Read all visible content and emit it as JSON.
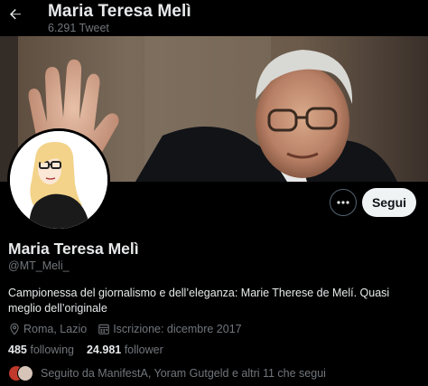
{
  "header": {
    "name": "Maria Teresa Melì",
    "tweet_count": "6.291 Tweet"
  },
  "profile": {
    "name": "Maria Teresa Melì",
    "handle": "@MT_Meli_",
    "bio": "Campionessa del giornalismo e dell’eleganza: Marie Therese de Melí. Quasi meglio dell’originale",
    "location": "Roma, Lazio",
    "joined": "Iscrizione: dicembre 2017",
    "following_count": "485",
    "following_label": "following",
    "followers_count": "24.981",
    "followers_label": "follower",
    "followed_by": "Seguito da ManifestA, Yoram Gutgeld e altri 11 che segui"
  },
  "actions": {
    "follow_label": "Segui"
  },
  "icons": {
    "back": "arrow-left-icon",
    "more": "more-dots-icon",
    "location": "location-pin-icon",
    "calendar": "calendar-icon"
  },
  "colors": {
    "background": "#000000",
    "text_primary": "#e7e9ea",
    "text_secondary": "#71767b",
    "follow_button_bg": "#eff3f4"
  }
}
